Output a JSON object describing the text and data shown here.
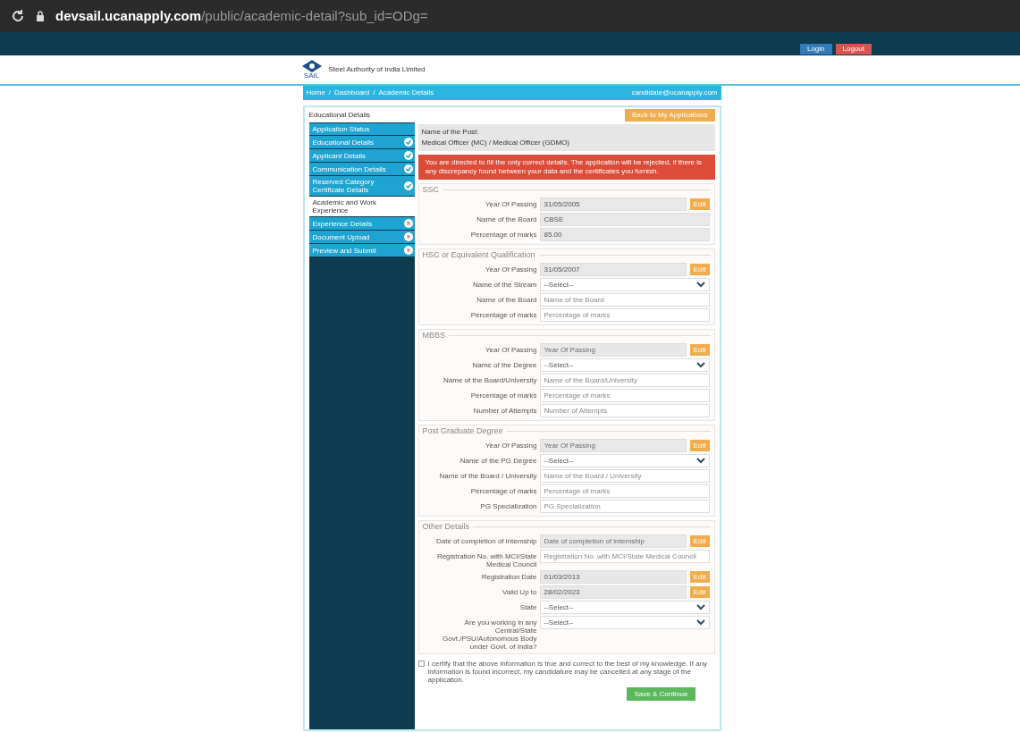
{
  "browser": {
    "url_host": "devsail.ucanapply.com",
    "url_path": "/public/academic-detail?sub_id=ODg="
  },
  "top_buttons": [
    {
      "label": "Login",
      "kind": "primary"
    },
    {
      "label": "Logout",
      "kind": "danger"
    }
  ],
  "header": {
    "title": "Steel Authority of India Limited",
    "logo_caption": "SAIL"
  },
  "breadcrumb": [
    "Home",
    "Dashboard",
    "Academic Details"
  ],
  "breadcrumb_separator": "/",
  "user_email": "candidate@ucanapply.com",
  "card": {
    "title": "Educational Details",
    "back_button": "Back to My Applications"
  },
  "sidebar": [
    {
      "label": "Application Status",
      "selected": false,
      "kind": "plain"
    },
    {
      "label": "Educational Details",
      "selected": false,
      "kind": "done"
    },
    {
      "label": "Applicant Details",
      "selected": false,
      "kind": "done"
    },
    {
      "label": "Communication Details",
      "selected": false,
      "kind": "done"
    },
    {
      "label": "Reserved Category Certificate Details",
      "selected": false,
      "kind": "done"
    },
    {
      "label": "Academic and Work Experience",
      "selected": true,
      "kind": "plain"
    },
    {
      "label": "Experience Details",
      "selected": false,
      "kind": "pending"
    },
    {
      "label": "Document Upload",
      "selected": false,
      "kind": "pending"
    },
    {
      "label": "Preview and Submit",
      "selected": false,
      "kind": "pending"
    }
  ],
  "post": {
    "label": "Name of the Post:",
    "value": "Medical Officer (MC) / Medical Officer (GDMO)"
  },
  "alert": "You are directed to fill the only correct details. The application will be rejected, if there is any discrepancy found between your data and the certificates you furnish.",
  "sections": [
    {
      "title": "SSC",
      "fields": [
        {
          "label": "Year Of Passing",
          "kind": "text",
          "value": "31/05/2005",
          "disabled": true,
          "button": "Edit"
        },
        {
          "label": "Name of the Board",
          "kind": "text",
          "value": "CBSE",
          "disabled": true
        },
        {
          "label": "Percentage of marks",
          "kind": "text",
          "value": "85.00",
          "disabled": true
        }
      ]
    },
    {
      "title": "HSC or Equivalent Qualification",
      "fields": [
        {
          "label": "Year Of Passing",
          "kind": "text",
          "value": "31/05/2007",
          "disabled": true,
          "button": "Edit"
        },
        {
          "label": "Name of the Stream",
          "kind": "select",
          "value": "--Select--",
          "disabled": false
        },
        {
          "label": "Name of the Board",
          "kind": "text",
          "placeholder": "Name of the Board",
          "disabled": false
        },
        {
          "label": "Percentage of marks",
          "kind": "text",
          "placeholder": "Percentage of marks",
          "disabled": false
        }
      ]
    },
    {
      "title": "MBBS",
      "fields": [
        {
          "label": "Year Of Passing",
          "kind": "text",
          "placeholder": "Year Of Passing",
          "disabled": true,
          "button": "Edit"
        },
        {
          "label": "Name of the Degree",
          "kind": "select",
          "value": "--Select--",
          "disabled": false
        },
        {
          "label": "Name of the Board/University",
          "kind": "text",
          "placeholder": "Name of the Board/University",
          "disabled": false
        },
        {
          "label": "Percentage of marks",
          "kind": "text",
          "placeholder": "Percentage of marks",
          "disabled": false
        },
        {
          "label": "Number of Attempts",
          "kind": "text",
          "placeholder": "Number of Attempts",
          "disabled": false
        }
      ]
    },
    {
      "title": "Post Graduate Degree",
      "fields": [
        {
          "label": "Year Of Passing",
          "kind": "text",
          "placeholder": "Year Of Passing",
          "disabled": true,
          "button": "Edit"
        },
        {
          "label": "Name of the PG Degree",
          "kind": "select",
          "value": "--Select--",
          "disabled": false
        },
        {
          "label": "Name of the Board / University",
          "kind": "text",
          "placeholder": "Name of the Board / University",
          "disabled": false
        },
        {
          "label": "Percentage of marks",
          "kind": "text",
          "placeholder": "Percentage of marks",
          "disabled": false
        },
        {
          "label": "PG Specialization",
          "kind": "text",
          "placeholder": "PG Specialization",
          "disabled": false
        }
      ]
    },
    {
      "title": "Other Details",
      "fields": [
        {
          "label": "Date of completion of internship",
          "kind": "text",
          "placeholder": "Date of completion of internship",
          "disabled": true,
          "button": "Edit"
        },
        {
          "label": "Registration No. with MCI/State Medical Council",
          "kind": "text",
          "placeholder": "Registration No. with MCI/State Medical Council",
          "disabled": false
        },
        {
          "label": "Registration Date",
          "kind": "text",
          "value": "01/03/2013",
          "disabled": true,
          "button": "Edit"
        },
        {
          "label": "Valid Up to",
          "kind": "text",
          "value": "28/02/2023",
          "disabled": true,
          "button": "Edit"
        },
        {
          "label": "State",
          "kind": "select",
          "value": "--Select--",
          "disabled": false
        },
        {
          "label": "Are you working in any Central/State Govt./PSU/Autonomous Body under Govt. of India?",
          "kind": "select",
          "value": "--Select--",
          "disabled": false
        }
      ]
    }
  ],
  "declaration": {
    "text": "I certify that the above information is true and correct to the best of my knowledge. If any information is found incorrect, my candidature may be cancelled at any stage of the application.",
    "checked": false
  },
  "submit": "Save & Continue"
}
